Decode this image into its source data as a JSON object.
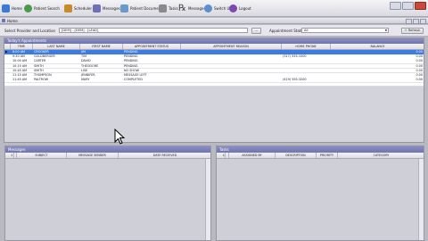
{
  "toolbar": {
    "buttons": [
      {
        "label": "Home",
        "icon": "home-icon",
        "color": "#3a7bd5"
      },
      {
        "label": "Patient Search",
        "icon": "patient-search-icon",
        "color": "#4a9a4a"
      },
      {
        "label": "Scheduler",
        "icon": "scheduler-icon",
        "color": "#c98a2a"
      },
      {
        "label": "Messages",
        "icon": "messages-icon",
        "color": "#6f6fb8"
      },
      {
        "label": "Patient Documents",
        "icon": "documents-icon",
        "color": "#6a9ac9"
      },
      {
        "label": "Tasks",
        "icon": "tasks-icon",
        "color": "#8a8a8a"
      },
      {
        "label": "Messages",
        "icon": "rx-messages-icon",
        "color": "#444444"
      },
      {
        "label": "Switch User",
        "icon": "switch-user-icon",
        "color": "#5b8fcf"
      },
      {
        "label": "Logout",
        "icon": "logout-icon",
        "color": "#7a4ab0"
      }
    ]
  },
  "window": {
    "title": "Home"
  },
  "filters": {
    "location_label": "Select Provider and Location",
    "location_value": "[DEM] - [DEM] - [LEAD]",
    "browse_label": "...",
    "status_label": "Appointment Status",
    "status_value": "All",
    "refresh_label": "Refresh"
  },
  "appointments": {
    "title": "Today's Appointments",
    "columns": [
      "TIME",
      "LAST NAME",
      "FIRST NAME",
      "APPOINTMENT STATUS",
      "APPOINTMENT REASON",
      "HOME PHONE",
      "BALANCE"
    ],
    "rows": [
      {
        "time": "8:00 AM",
        "last": "CROOKER",
        "first": "JIM",
        "status": "PENDING",
        "reason": "",
        "phone": "",
        "balance": "0.00"
      },
      {
        "time": "9:30 AM",
        "last": "GOLDBERGER",
        "first": "TIM",
        "status": "PENDING",
        "reason": "",
        "phone": "(317) 555-1000",
        "balance": "0.00"
      },
      {
        "time": "10:00 AM",
        "last": "CARTER",
        "first": "DAVID",
        "status": "PENDING",
        "reason": "",
        "phone": "",
        "balance": "0.00"
      },
      {
        "time": "10:15 AM",
        "last": "SMITH",
        "first": "THEODORE",
        "status": "PENDING",
        "reason": "",
        "phone": "",
        "balance": "0.00"
      },
      {
        "time": "10:45 AM",
        "last": "SMITH",
        "first": "LISE",
        "status": "NO SHOW",
        "reason": "",
        "phone": "",
        "balance": "0.00"
      },
      {
        "time": "11:15 AM",
        "last": "THOMPSON",
        "first": "JENNIFER",
        "status": "MESSAGE LEFT",
        "reason": "",
        "phone": "",
        "balance": "0.00"
      },
      {
        "time": "11:45 AM",
        "last": "PALTROW",
        "first": "MARY",
        "status": "COMPLETED",
        "reason": "",
        "phone": "(419) 555-3200",
        "balance": "0.00"
      }
    ]
  },
  "messages": {
    "title": "Messages",
    "columns": [
      "",
      "SUBJECT",
      "MESSAGE SENDER",
      "DATE RECEIVED"
    ]
  },
  "tasks": {
    "title": "Tasks",
    "columns": [
      "",
      "ASSIGNED BY",
      "DESCRIPTION",
      "PRIORITY",
      "CATEGORY"
    ]
  }
}
